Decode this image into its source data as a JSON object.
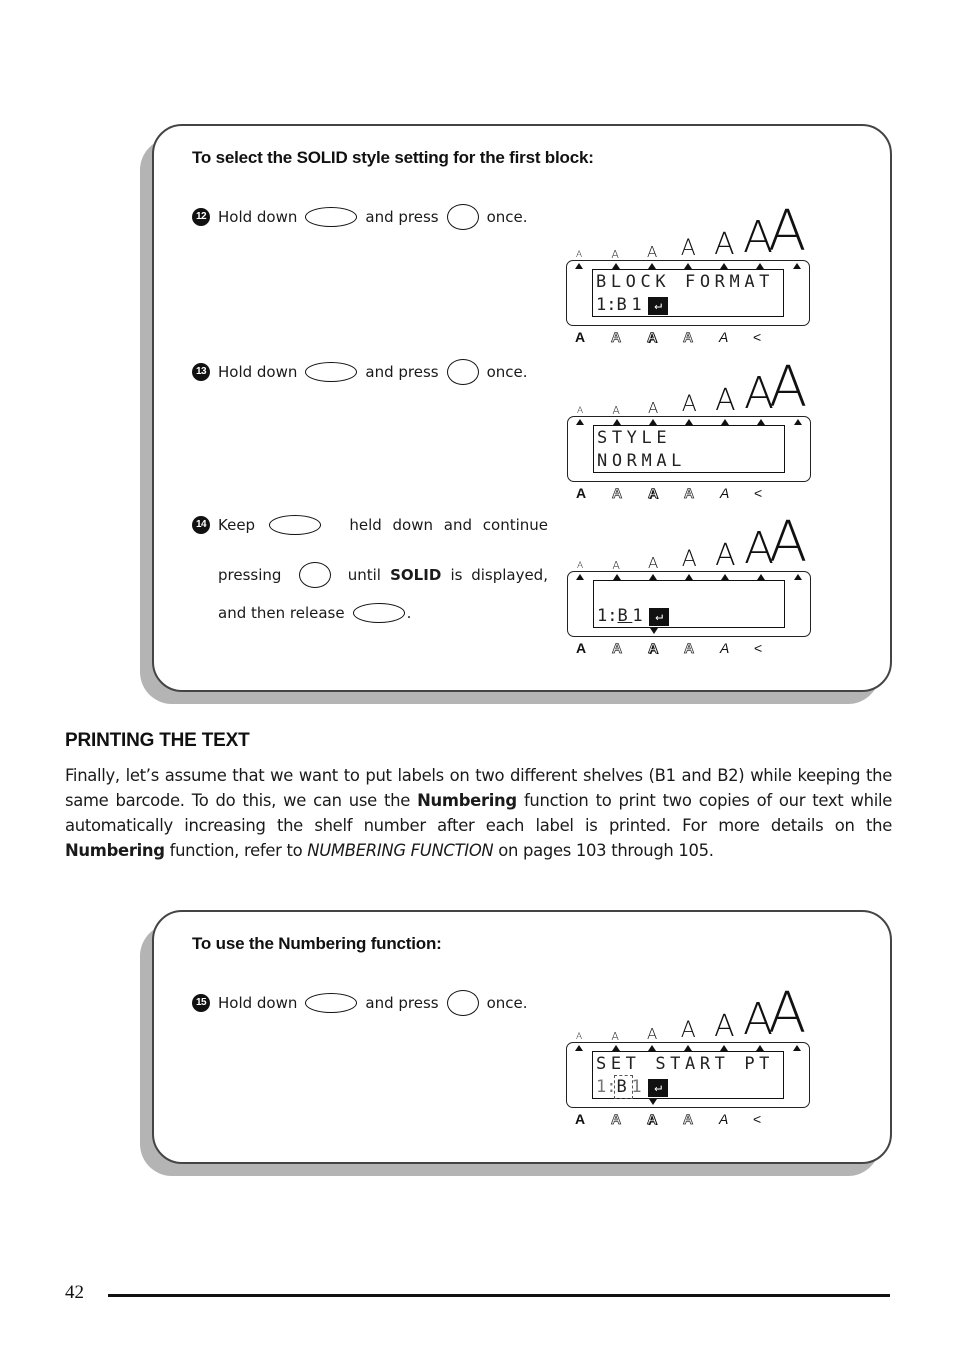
{
  "section1": {
    "title": "To select the SOLID style setting for the first block:",
    "steps": [
      {
        "number": "12",
        "parts": [
          "Hold down",
          "and press",
          "once."
        ],
        "keys": [
          "code-key",
          "style-key"
        ],
        "display": {
          "line1": "BLOCK FORMAT",
          "line2_prefix": "1:",
          "line2_text": "B1",
          "return_symbol": "↵",
          "cursor_marker": false
        }
      },
      {
        "number": "13",
        "parts": [
          "Hold down",
          "and press",
          "once."
        ],
        "keys": [
          "code-key",
          "style-key"
        ],
        "display": {
          "line1": "STYLE",
          "line2": "NORMAL"
        }
      },
      {
        "number": "14",
        "line1_parts": [
          "Keep",
          "held down and continue"
        ],
        "line2_parts": [
          "pressing",
          "until",
          "SOLID",
          "is displayed,"
        ],
        "line3_parts": [
          "and then release",
          "."
        ],
        "keys": [
          "code-key",
          "style-key",
          "code-key"
        ],
        "display": {
          "line1": "",
          "line2_prefix": "1:",
          "line2_underlined": "B",
          "line2_text": "1",
          "return_symbol": "↵",
          "cursor_marker": true
        }
      }
    ]
  },
  "printing": {
    "heading": "PRINTING THE TEXT",
    "para_1": "Finally, let’s assume that we want to put labels on two different shelves (B1 and B2) while keeping the same barcode. To do this, we can use the ",
    "bold_1": "Numbering",
    "para_2": " function to print two copies of our text while automatically increasing the shelf number after each label is printed. For more details on the ",
    "bold_2": "Numbering",
    "para_3": " function, refer to ",
    "italic_ref": "NUMBERING FUNCTION",
    "para_4": " on pages 103 through 105."
  },
  "section2": {
    "title": "To use the Numbering function:",
    "steps": [
      {
        "number": "15",
        "parts": [
          "Hold down",
          "and press",
          "once."
        ],
        "keys": [
          "code-key",
          "numbering-key"
        ],
        "display": {
          "line1": "SET START PT",
          "line2_prefix": "1:",
          "line2_blinking": "B",
          "line2_text": "1",
          "return_symbol": "↵",
          "cursor_marker": true
        }
      }
    ]
  },
  "lcd_common": {
    "size_indicators": [
      "A",
      "A",
      "A",
      "A",
      "A",
      "A",
      "A"
    ],
    "style_indicators": [
      "A",
      "A",
      "A",
      "A",
      "A",
      "A"
    ],
    "style_indicator_names": [
      "bold",
      "outline",
      "shadow",
      "solid",
      "italic",
      "vertical"
    ]
  },
  "footer": {
    "page_number": "42"
  }
}
